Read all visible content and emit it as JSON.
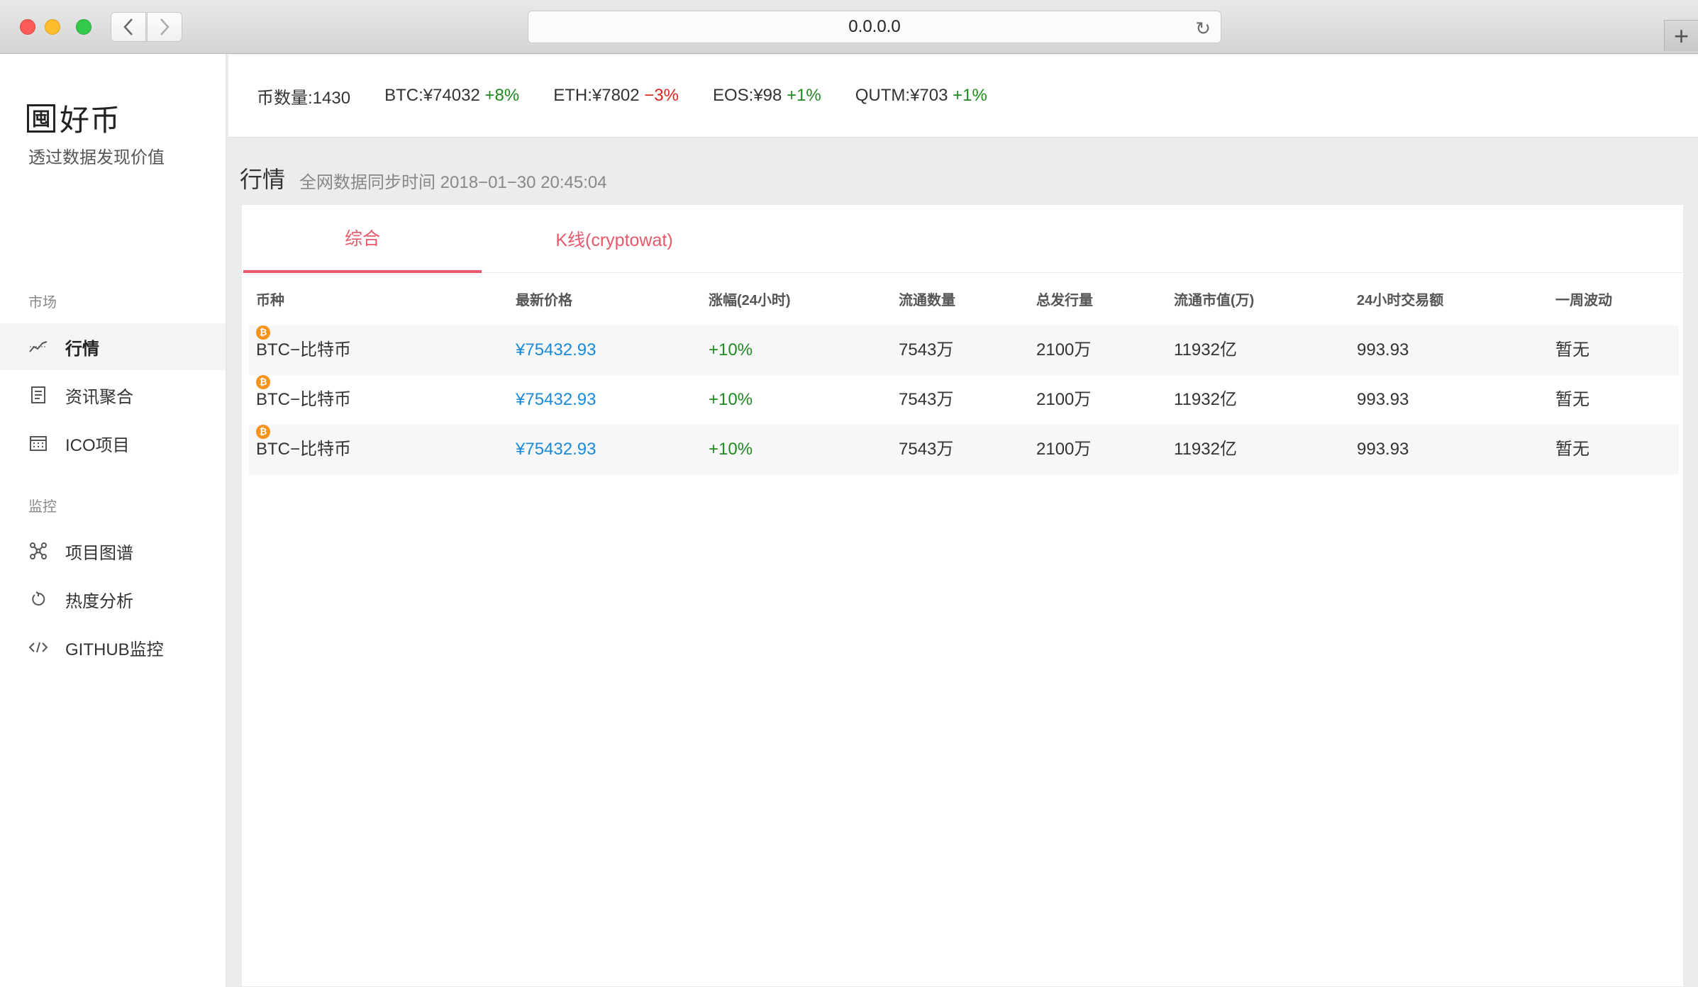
{
  "browser": {
    "url": "0.0.0.0"
  },
  "sidebar": {
    "brand_icon_char": "囤",
    "brand_title": "好币",
    "brand_subtitle": "透过数据发现价值",
    "sections": [
      {
        "label": "市场",
        "items": [
          {
            "label": "行情",
            "icon": "chart-trend-icon",
            "active": true
          },
          {
            "label": "资讯聚合",
            "icon": "news-icon",
            "active": false
          },
          {
            "label": "ICO项目",
            "icon": "calendar-icon",
            "active": false
          }
        ]
      },
      {
        "label": "监控",
        "items": [
          {
            "label": "项目图谱",
            "icon": "graph-icon",
            "active": false
          },
          {
            "label": "热度分析",
            "icon": "timer-icon",
            "active": false
          },
          {
            "label": "GITHUB监控",
            "icon": "code-icon",
            "active": false
          }
        ]
      }
    ]
  },
  "ticker": {
    "count_label": "币数量:1430",
    "items": [
      {
        "label": "BTC:¥74032",
        "change": "+8%",
        "direction": "up"
      },
      {
        "label": "ETH:¥7802",
        "change": "−3%",
        "direction": "down"
      },
      {
        "label": "EOS:¥98",
        "change": "+1%",
        "direction": "up"
      },
      {
        "label": "QUTM:¥703",
        "change": "+1%",
        "direction": "up"
      }
    ]
  },
  "section": {
    "title": "行情",
    "sync_text": "全网数据同步时间 2018−01−30 20:45:04"
  },
  "tabs": [
    {
      "label": "综合",
      "active": true
    },
    {
      "label": "K线(cryptowat)",
      "active": false
    }
  ],
  "table": {
    "headers": [
      "币种",
      "最新价格",
      "涨幅(24小时)",
      "流通数量",
      "总发行量",
      "流通市值(万)",
      "24小时交易额",
      "一周波动"
    ],
    "rows": [
      {
        "coin": "BTC−比特币",
        "price": "¥75432.93",
        "change": "+10%",
        "circulating": "7543万",
        "total_supply": "2100万",
        "market_cap": "11932亿",
        "volume_24h": "993.93",
        "weekly": "暂无"
      },
      {
        "coin": "BTC−比特币",
        "price": "¥75432.93",
        "change": "+10%",
        "circulating": "7543万",
        "total_supply": "2100万",
        "market_cap": "11932亿",
        "volume_24h": "993.93",
        "weekly": "暂无"
      },
      {
        "coin": "BTC−比特币",
        "price": "¥75432.93",
        "change": "+10%",
        "circulating": "7543万",
        "total_supply": "2100万",
        "market_cap": "11932亿",
        "volume_24h": "993.93",
        "weekly": "暂无"
      }
    ]
  },
  "colors": {
    "accent": "#e8586a",
    "price": "#1a8ad8",
    "up": "#1f8a1f",
    "down": "#e02020",
    "coin_icon": "#f7931a"
  }
}
